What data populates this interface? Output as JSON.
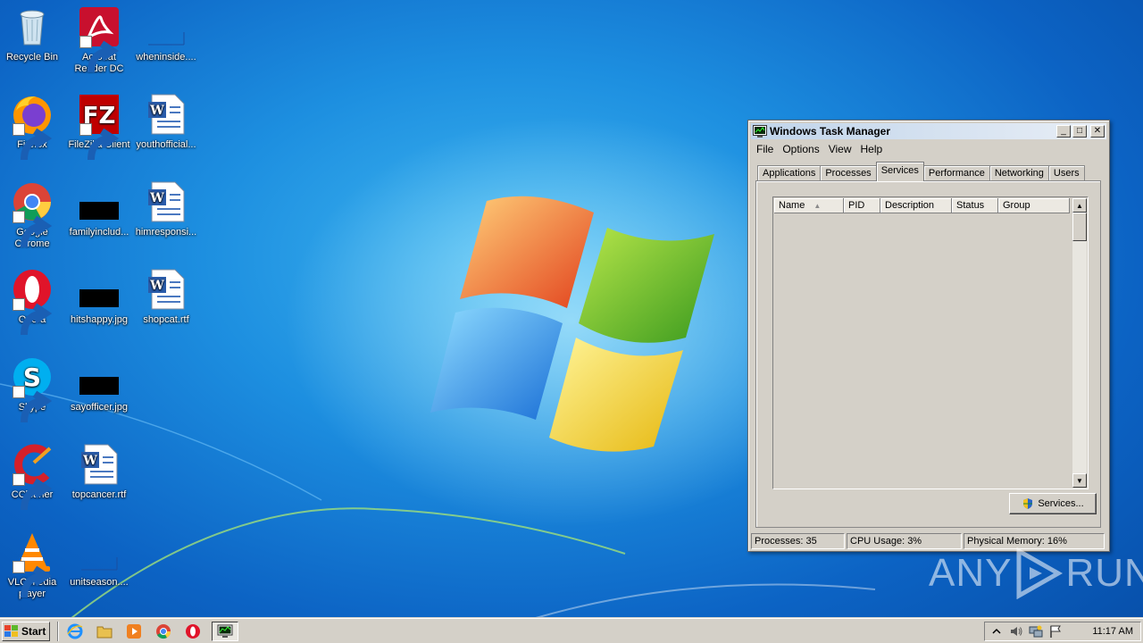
{
  "desktop": {
    "icons": [
      {
        "label": "Recycle Bin",
        "icon": "recycle-bin-icon",
        "shortcut": false
      },
      {
        "label": "Acrobat Reader DC",
        "icon": "acrobat-reader-icon",
        "shortcut": true
      },
      {
        "label": "wheninside....",
        "icon": "image-file-icon",
        "shortcut": false
      },
      {
        "label": "Firefox",
        "icon": "firefox-icon",
        "shortcut": true
      },
      {
        "label": "FileZilla Client",
        "icon": "filezilla-icon",
        "shortcut": true
      },
      {
        "label": "youthofficial...",
        "icon": "word-document-icon",
        "shortcut": false
      },
      {
        "label": "Google Chrome",
        "icon": "chrome-icon",
        "shortcut": true
      },
      {
        "label": "familyinclud...",
        "icon": "image-file-icon",
        "shortcut": false
      },
      {
        "label": "himresponsi...",
        "icon": "word-document-icon",
        "shortcut": false
      },
      {
        "label": "Opera",
        "icon": "opera-icon",
        "shortcut": true
      },
      {
        "label": "hitshappy.jpg",
        "icon": "image-file-icon",
        "shortcut": false
      },
      {
        "label": "shopcat.rtf",
        "icon": "word-document-icon",
        "shortcut": false
      },
      {
        "label": "Skype",
        "icon": "skype-icon",
        "shortcut": true
      },
      {
        "label": "sayofficer.jpg",
        "icon": "image-file-icon",
        "shortcut": false
      },
      {
        "label": "CCleaner",
        "icon": "ccleaner-icon",
        "shortcut": true
      },
      {
        "label": "topcancer.rtf",
        "icon": "word-document-icon",
        "shortcut": false
      },
      {
        "label": "VLC media player",
        "icon": "vlc-icon",
        "shortcut": true
      },
      {
        "label": "unitseason....",
        "icon": "image-file-icon",
        "shortcut": false
      }
    ]
  },
  "taskmgr": {
    "title": "Windows Task Manager",
    "menu": [
      "File",
      "Options",
      "View",
      "Help"
    ],
    "tabs": [
      "Applications",
      "Processes",
      "Services",
      "Performance",
      "Networking",
      "Users"
    ],
    "active_tab": "Services",
    "columns": [
      "Name",
      "PID",
      "Description",
      "Status",
      "Group"
    ],
    "services_button": "Services...",
    "status": {
      "processes": "Processes: 35",
      "cpu": "CPU Usage: 3%",
      "memory": "Physical Memory: 16%"
    }
  },
  "taskbar": {
    "start_label": "Start",
    "quick_launch": [
      "internet-explorer-icon",
      "explorer-folder-icon",
      "media-player-icon",
      "chrome-icon",
      "opera-icon",
      "task-manager-icon"
    ],
    "tray_icons": [
      "show-hidden-icons-icon",
      "speaker-icon",
      "network-icon",
      "action-center-flag-icon"
    ],
    "clock": "11:17 AM"
  },
  "watermark": {
    "left": "ANY",
    "right": "RUN"
  },
  "colors": {
    "desktop_blue": "#1d8fe0",
    "window_face": "#d4d0c8",
    "title_gradient": "#c0d4ea"
  }
}
